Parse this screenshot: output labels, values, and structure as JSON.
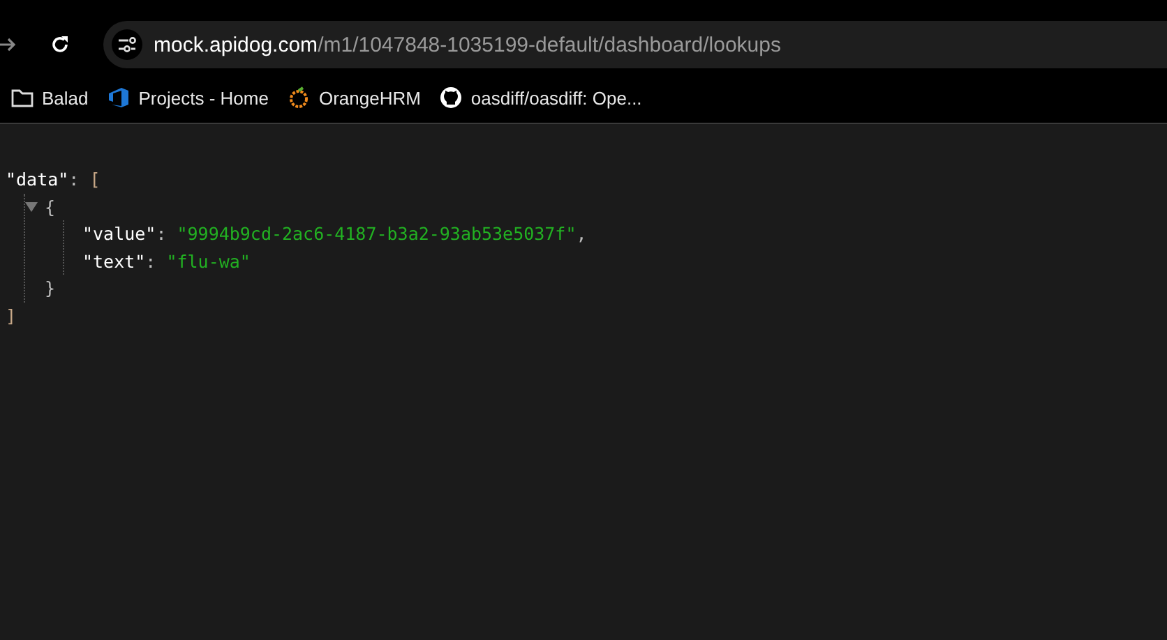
{
  "address": {
    "host": "mock.apidog.com",
    "path": "/m1/1047848-1035199-default/dashboard/lookups"
  },
  "bookmarks": [
    {
      "label": "Balad",
      "kind": "folder"
    },
    {
      "label": "Projects - Home",
      "kind": "devops"
    },
    {
      "label": "OrangeHRM",
      "kind": "orange"
    },
    {
      "label": "oasdiff/oasdiff: Ope...",
      "kind": "github"
    }
  ],
  "json_view": [
    {
      "tokens": [
        {
          "kind": "key",
          "text": "\"data\""
        },
        {
          "kind": "punct",
          "text": ": "
        },
        {
          "kind": "bracket",
          "text": "["
        }
      ],
      "close": [
        {
          "kind": "bracket",
          "text": "]"
        }
      ],
      "children": [
        {
          "tokens": [
            {
              "kind": "punct",
              "text": "{"
            }
          ],
          "expanded": true,
          "close": [
            {
              "kind": "punct",
              "text": "}"
            }
          ],
          "children": [
            {
              "tokens": [
                {
                  "kind": "key",
                  "text": "\"value\""
                },
                {
                  "kind": "punct",
                  "text": ": "
                },
                {
                  "kind": "string",
                  "text": "\"9994b9cd-2ac6-4187-b3a2-93ab53e5037f\""
                },
                {
                  "kind": "punct",
                  "text": ","
                }
              ]
            },
            {
              "tokens": [
                {
                  "kind": "key",
                  "text": "\"text\""
                },
                {
                  "kind": "punct",
                  "text": ": "
                },
                {
                  "kind": "string",
                  "text": "\"flu-wa\""
                }
              ]
            }
          ]
        }
      ]
    }
  ]
}
